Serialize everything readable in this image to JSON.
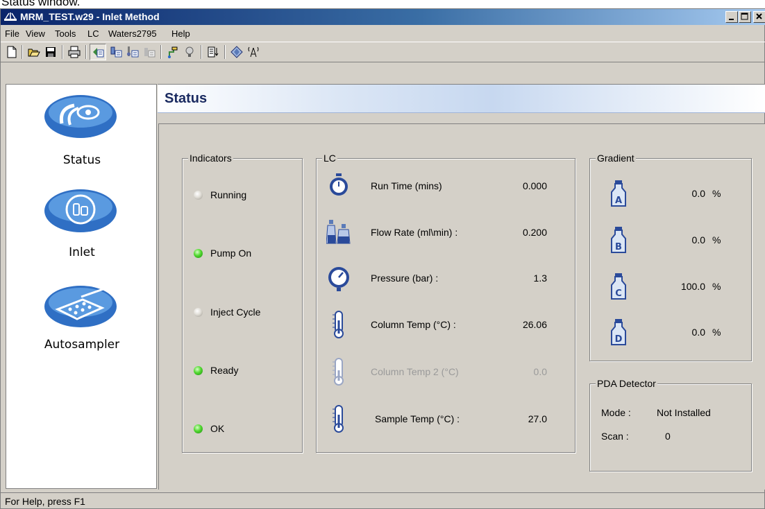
{
  "caption": "Status window.",
  "window": {
    "title": "MRM_TEST.w29 - Inlet Method"
  },
  "menu": [
    "File",
    "View",
    "Tools",
    "LC",
    "Waters2795",
    "Help"
  ],
  "toolbar_icons": [
    "new-icon",
    "open-icon",
    "save-icon",
    "print-icon",
    "status-icon",
    "inlet-icon",
    "inlet-settings-icon",
    "inlet-disabled-icon",
    "tune-icon",
    "light-icon",
    "load-icon",
    "eject-icon",
    "network-icon"
  ],
  "nav": {
    "items": [
      {
        "label": "Status",
        "icon": "status-eye-icon"
      },
      {
        "label": "Inlet",
        "icon": "inlet-bottles-icon"
      },
      {
        "label": "Autosampler",
        "icon": "autosampler-tray-icon"
      }
    ]
  },
  "header": {
    "title": "Status"
  },
  "indicators": {
    "title": "Indicators",
    "items": [
      {
        "label": "Running",
        "state": "off"
      },
      {
        "label": "Pump On",
        "state": "on"
      },
      {
        "label": "Inject Cycle",
        "state": "off"
      },
      {
        "label": "Ready",
        "state": "on"
      },
      {
        "label": "OK",
        "state": "on"
      }
    ]
  },
  "lc": {
    "title": "LC",
    "items": [
      {
        "label": "Run Time (mins)",
        "value": "0.000",
        "icon": "stopwatch-icon",
        "enabled": true
      },
      {
        "label": "Flow Rate (ml\\min) :",
        "value": "0.200",
        "icon": "solvent-bottles-icon",
        "enabled": true
      },
      {
        "label": "Pressure (bar) :",
        "value": "1.3",
        "icon": "pressure-gauge-icon",
        "enabled": true
      },
      {
        "label": "Column Temp (°C) :",
        "value": "26.06",
        "icon": "thermometer-icon",
        "enabled": true
      },
      {
        "label": "Column Temp 2 (°C)",
        "value": "0.0",
        "icon": "thermometer-icon",
        "enabled": false
      },
      {
        "label": "Sample Temp (°C) :",
        "value": "27.0",
        "icon": "thermometer-icon",
        "enabled": true
      }
    ]
  },
  "gradient": {
    "title": "Gradient",
    "unit": "%",
    "items": [
      {
        "letter": "A",
        "value": "0.0"
      },
      {
        "letter": "B",
        "value": "0.0"
      },
      {
        "letter": "C",
        "value": "100.0"
      },
      {
        "letter": "D",
        "value": "0.0"
      }
    ]
  },
  "pda": {
    "title": "PDA Detector",
    "mode_label": "Mode :",
    "mode_value": "Not Installed",
    "scan_label": "Scan :",
    "scan_value": "0"
  },
  "statusbar": {
    "text": "For Help, press F1"
  },
  "colors": {
    "led_on": "#3fcf25",
    "led_off": "#c8c4bc",
    "title_bar": "#0a246a",
    "header_text": "#1a2a60"
  }
}
